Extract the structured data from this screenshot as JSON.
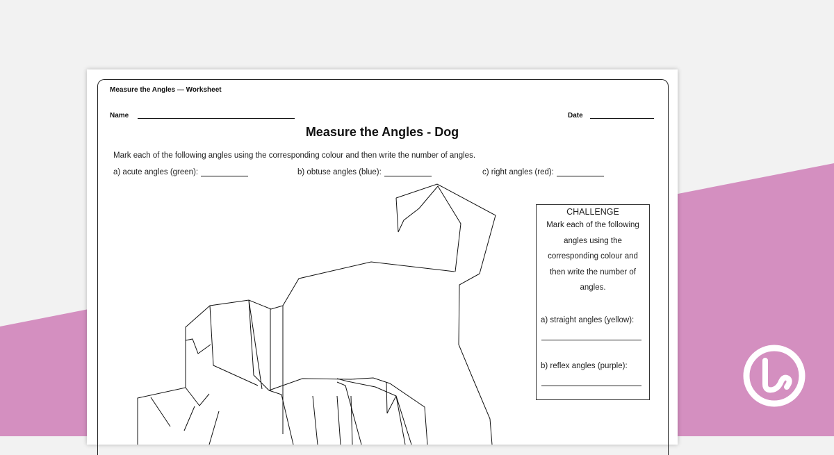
{
  "worksheet": {
    "header_title": "Measure the Angles — Worksheet",
    "name_label": "Name",
    "date_label": "Date",
    "title": "Measure the Angles - Dog",
    "instructions": "Mark each of the following angles using the corresponding colour and then write the number of angles.",
    "questions": {
      "a": "a) acute angles (green):",
      "b": "b) obtuse angles (blue):",
      "c": "c) right angles (red):"
    }
  },
  "challenge": {
    "title": "CHALLENGE",
    "body_lines": [
      "Mark each of the following",
      "angles using the",
      "corresponding colour and",
      "then write the number of",
      "angles."
    ],
    "q1": "a) straight angles (yellow):",
    "q2": "b) reflex angles (purple):"
  },
  "colors": {
    "background": "#f2f2f2",
    "accent_band": "#d48fc0",
    "logo": "#ffffff"
  },
  "logo_icon": "teach-starter-logo-icon"
}
